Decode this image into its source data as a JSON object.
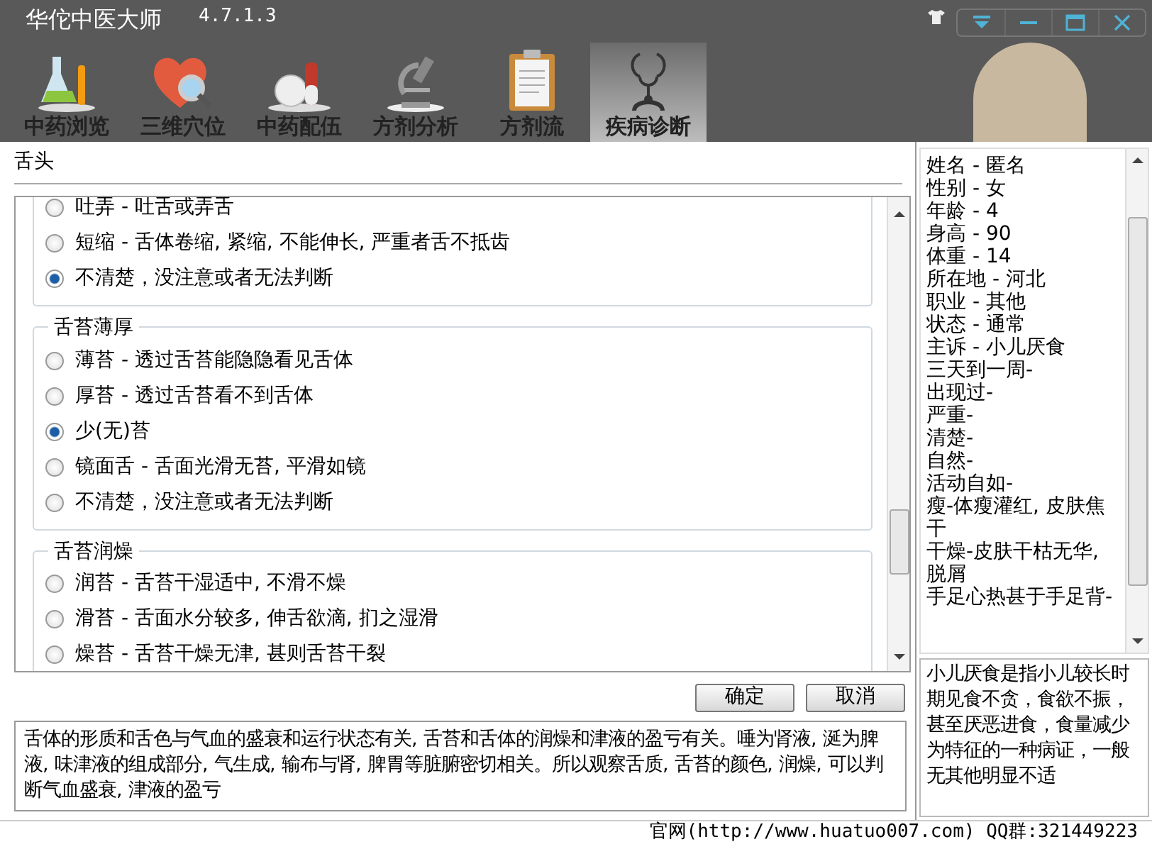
{
  "window": {
    "title": "华佗中医大师",
    "version": "4.7.1.3"
  },
  "tabs": [
    {
      "label": "中药浏览",
      "selected": false
    },
    {
      "label": "三维穴位",
      "selected": false
    },
    {
      "label": "中药配伍",
      "selected": false
    },
    {
      "label": "方剂分析",
      "selected": false
    },
    {
      "label": "方剂流",
      "selected": false
    },
    {
      "label": "疾病诊断",
      "selected": true
    }
  ],
  "section": {
    "title": "舌头"
  },
  "groups": [
    {
      "options": [
        {
          "label": "吐弄 - 吐舌或弄舌",
          "selected": false
        },
        {
          "label": "短缩 - 舌体卷缩, 紧缩, 不能伸长, 严重者舌不抵齿",
          "selected": false
        },
        {
          "label": "不清楚，没注意或者无法判断",
          "selected": true
        }
      ]
    },
    {
      "title": "舌苔薄厚",
      "options": [
        {
          "label": "薄苔 - 透过舌苔能隐隐看见舌体",
          "selected": false
        },
        {
          "label": "厚苔 - 透过舌苔看不到舌体",
          "selected": false
        },
        {
          "label": "少(无)苔",
          "selected": true
        },
        {
          "label": "镜面舌 - 舌面光滑无苔, 平滑如镜",
          "selected": false
        },
        {
          "label": "不清楚，没注意或者无法判断",
          "selected": false
        }
      ]
    },
    {
      "title": "舌苔润燥",
      "options": [
        {
          "label": "润苔 - 舌苔干湿适中, 不滑不燥",
          "selected": false
        },
        {
          "label": "滑苔 - 舌面水分较多, 伸舌欲滴, 扪之湿滑",
          "selected": false
        },
        {
          "label": "燥苔 - 舌苔干燥无津, 甚则舌苔干裂",
          "selected": false
        }
      ]
    }
  ],
  "buttons": [
    "确定",
    "取消"
  ],
  "explanation": "舌体的形质和舌色与气血的盛衰和运行状态有关, 舌苔和舌体的润燥和津液的盈亏有关。唾为肾液, 涎为脾液, 味津液的组成部分, 气生成, 输布与肾, 脾胃等脏腑密切相关。所以观察舌质, 舌苔的颜色, 润燥, 可以判断气血盛衰, 津液的盈亏",
  "patient_info": [
    "姓名 - 匿名",
    "性别 - 女",
    "年龄 - 4",
    "身高 - 90",
    "体重 - 14",
    "所在地 - 河北",
    "职业 - 其他",
    "状态 - 通常",
    "主诉 - 小儿厌食",
    "三天到一周-",
    "出现过-",
    "严重-",
    "清楚-",
    "自然-",
    "活动自如-",
    "瘦-体瘦灌红, 皮肤焦干",
    "干燥-皮肤干枯无华, 脱屑",
    "手足心热甚于手足背-"
  ],
  "disease_description": "小儿厌食是指小儿较长时期见食不贪，食欲不振，甚至厌恶进食，食量减少为特征的一种病证，一般无其他明显不适",
  "footer": "官网(http://www.huatuo007.com) QQ群:321449223"
}
